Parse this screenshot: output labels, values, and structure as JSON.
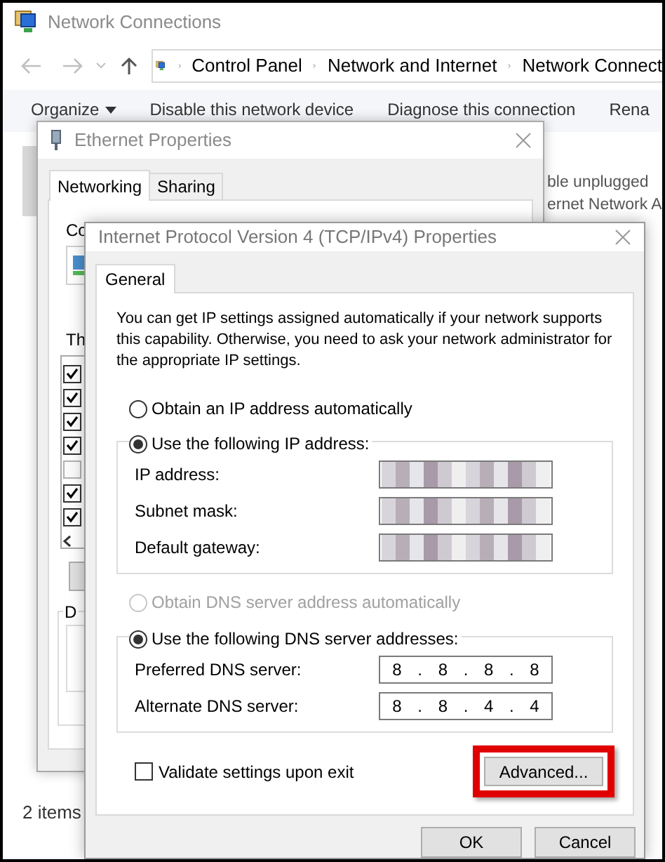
{
  "explorer": {
    "title": "Network Connections",
    "breadcrumb": [
      "Control Panel",
      "Network and Internet",
      "Network Connect"
    ],
    "toolbar": [
      "Organize",
      "Disable this network device",
      "Diagnose this connection",
      "Rena"
    ],
    "details": [
      "ble unplugged",
      "ernet Network A"
    ],
    "status": "2 items"
  },
  "ethernet": {
    "title": "Ethernet Properties",
    "tabs": [
      {
        "label": "Networking",
        "selected": true
      },
      {
        "label": "Sharing",
        "selected": false
      }
    ],
    "connect_label": "Co",
    "list_label": "Th",
    "items": [
      {
        "checked": true
      },
      {
        "checked": true
      },
      {
        "checked": true
      },
      {
        "checked": true
      },
      {
        "checked": false
      },
      {
        "checked": true
      },
      {
        "checked": true
      }
    ],
    "group_label": "D"
  },
  "ipv4": {
    "title": "Internet Protocol Version 4 (TCP/IPv4) Properties",
    "tabs": [
      {
        "label": "General",
        "selected": true
      }
    ],
    "description": "You can get IP settings assigned automatically if your network supports this capability. Otherwise, you need to ask your network administrator for the appropriate IP settings.",
    "ip_auto": {
      "label": "Obtain an IP address automatically",
      "selected": false,
      "disabled": false
    },
    "ip_manual": {
      "label": "Use the following IP address:",
      "selected": true,
      "disabled": false
    },
    "ip_fields": [
      {
        "label": "IP address:",
        "redacted": true
      },
      {
        "label": "Subnet mask:",
        "redacted": true
      },
      {
        "label": "Default gateway:",
        "redacted": true
      }
    ],
    "dns_auto": {
      "label": "Obtain DNS server address automatically",
      "selected": false,
      "disabled": true
    },
    "dns_manual": {
      "label": "Use the following DNS server addresses:",
      "selected": true,
      "disabled": false
    },
    "dns_fields": [
      {
        "label": "Preferred DNS server:",
        "value": "8 . 8 . 8 . 8"
      },
      {
        "label": "Alternate DNS server:",
        "value": "8 . 8 . 4 . 4"
      }
    ],
    "validate": {
      "label": "Validate settings upon exit",
      "checked": false
    },
    "advanced": {
      "label": "Advanced...",
      "highlighted": true
    },
    "buttons": [
      "OK",
      "Cancel"
    ]
  }
}
